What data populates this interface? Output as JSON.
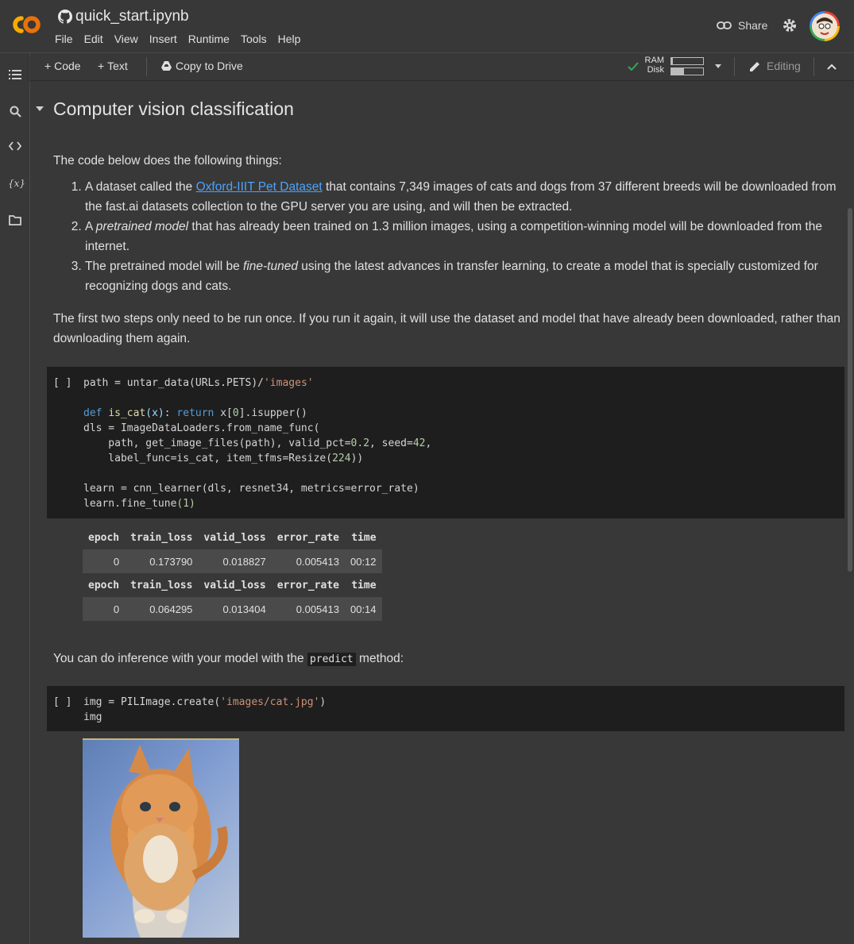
{
  "app": {
    "file_title": "quick_start.ipynb",
    "menu": [
      "File",
      "Edit",
      "View",
      "Insert",
      "Runtime",
      "Tools",
      "Help"
    ],
    "share_label": "Share"
  },
  "toolbar": {
    "add_code": "Code",
    "add_text": "Text",
    "copy_to_drive": "Copy to Drive",
    "ram_label": "RAM",
    "disk_label": "Disk",
    "ram_usage": 0.05,
    "disk_usage": 0.4,
    "editing_label": "Editing"
  },
  "notebook": {
    "section_title": "Computer vision classification",
    "intro": "The code below does the following things:",
    "list": [
      {
        "prefix": "A dataset called the ",
        "link": "Oxford-IIIT Pet Dataset",
        "suffix": " that contains 7,349 images of cats and dogs from 37 different breeds will be downloaded from the fast.ai datasets collection to the GPU server you are using, and will then be extracted."
      },
      {
        "prefix": "A ",
        "em": "pretrained model",
        "suffix": " that has already been trained on 1.3 million images, using a competition-winning model will be downloaded from the internet."
      },
      {
        "prefix": "The pretrained model will be ",
        "em": "fine-tuned",
        "suffix": " using the latest advances in transfer learning, to create a model that is specially customized for recognizing dogs and cats."
      }
    ],
    "para2": "The first two steps only need to be run once. If you run it again, it will use the dataset and model that have already been downloaded, rather than downloading them again.",
    "cell1_bracket": "[ ]",
    "cell1_code": [
      "path = untar_data(URLs.PETS)/'images'",
      "",
      "def is_cat(x): return x[0].isupper()",
      "dls = ImageDataLoaders.from_name_func(",
      "    path, get_image_files(path), valid_pct=0.2, seed=42,",
      "    label_func=is_cat, item_tfms=Resize(224))",
      "",
      "learn = cnn_learner(dls, resnet34, metrics=error_rate)",
      "learn.fine_tune(1)"
    ],
    "table_headers": [
      "epoch",
      "train_loss",
      "valid_loss",
      "error_rate",
      "time"
    ],
    "table1_row": [
      "0",
      "0.173790",
      "0.018827",
      "0.005413",
      "00:12"
    ],
    "table2_row": [
      "0",
      "0.064295",
      "0.013404",
      "0.005413",
      "00:14"
    ],
    "inference_prefix": "You can do inference with your model with the ",
    "inference_code": "predict",
    "inference_suffix": " method:",
    "cell2_bracket": "[ ]",
    "cell2_code": [
      "img = PILImage.create('images/cat.jpg')",
      "img"
    ]
  }
}
